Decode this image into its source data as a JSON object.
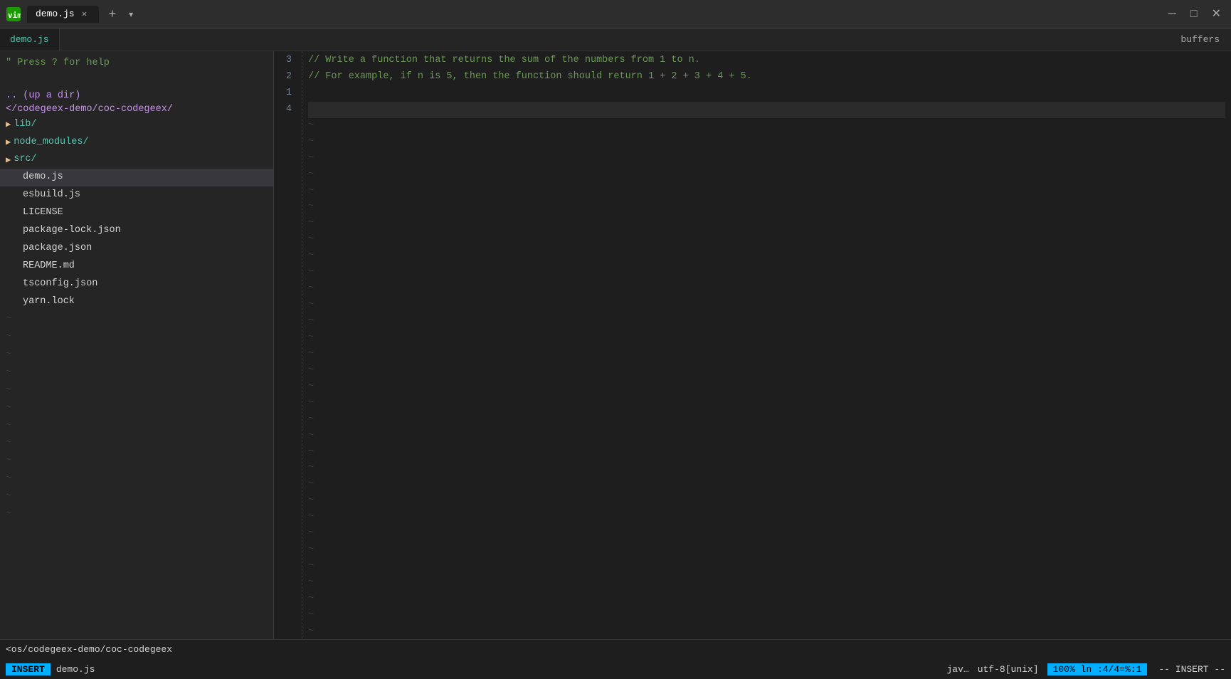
{
  "titlebar": {
    "app_name": "vim",
    "tab_label": "demo.js",
    "new_tab_icon": "+",
    "dropdown_icon": "▾",
    "minimize_icon": "─",
    "maximize_icon": "□",
    "close_icon": "✕",
    "buffers_label": "buffers"
  },
  "buffer_tab": {
    "label": "demo.js"
  },
  "sidebar": {
    "help_text": "\" Press ? for help",
    "nav_up": ".. (up a dir)",
    "root_dir": "</codegeex-demo/coc-codegeex/",
    "items": [
      {
        "type": "folder",
        "name": "lib/",
        "expanded": false
      },
      {
        "type": "folder",
        "name": "node_modules/",
        "expanded": false
      },
      {
        "type": "folder",
        "name": "src/",
        "expanded": false
      },
      {
        "type": "file",
        "name": "demo.js",
        "active": true
      },
      {
        "type": "file",
        "name": "esbuild.js"
      },
      {
        "type": "file",
        "name": "LICENSE"
      },
      {
        "type": "file",
        "name": "package-lock.json"
      },
      {
        "type": "file",
        "name": "package.json"
      },
      {
        "type": "file",
        "name": "README.md"
      },
      {
        "type": "file",
        "name": "tsconfig.json"
      },
      {
        "type": "file",
        "name": "yarn.lock"
      }
    ]
  },
  "editor": {
    "lines": [
      {
        "num": "3",
        "content": "// Write a function that returns the sum of the numbers from 1 to n.",
        "type": "comment"
      },
      {
        "num": "2",
        "content": "// For example, if n is 5, then the function should return 1 + 2 + 3 + 4 + 5.",
        "type": "comment"
      },
      {
        "num": "1",
        "content": "",
        "type": "normal"
      },
      {
        "num": "4",
        "content": "",
        "type": "cursor"
      }
    ],
    "tilde_count": 30
  },
  "statusbar": {
    "path": "<os/codegeex-demo/coc-codegeex",
    "mode_badge": "INSERT",
    "filename": "demo.js",
    "language": "jav…",
    "encoding": "utf-8[unix]",
    "position": "100%  ln :4/4=%:1",
    "mode_label": "-- INSERT --"
  }
}
